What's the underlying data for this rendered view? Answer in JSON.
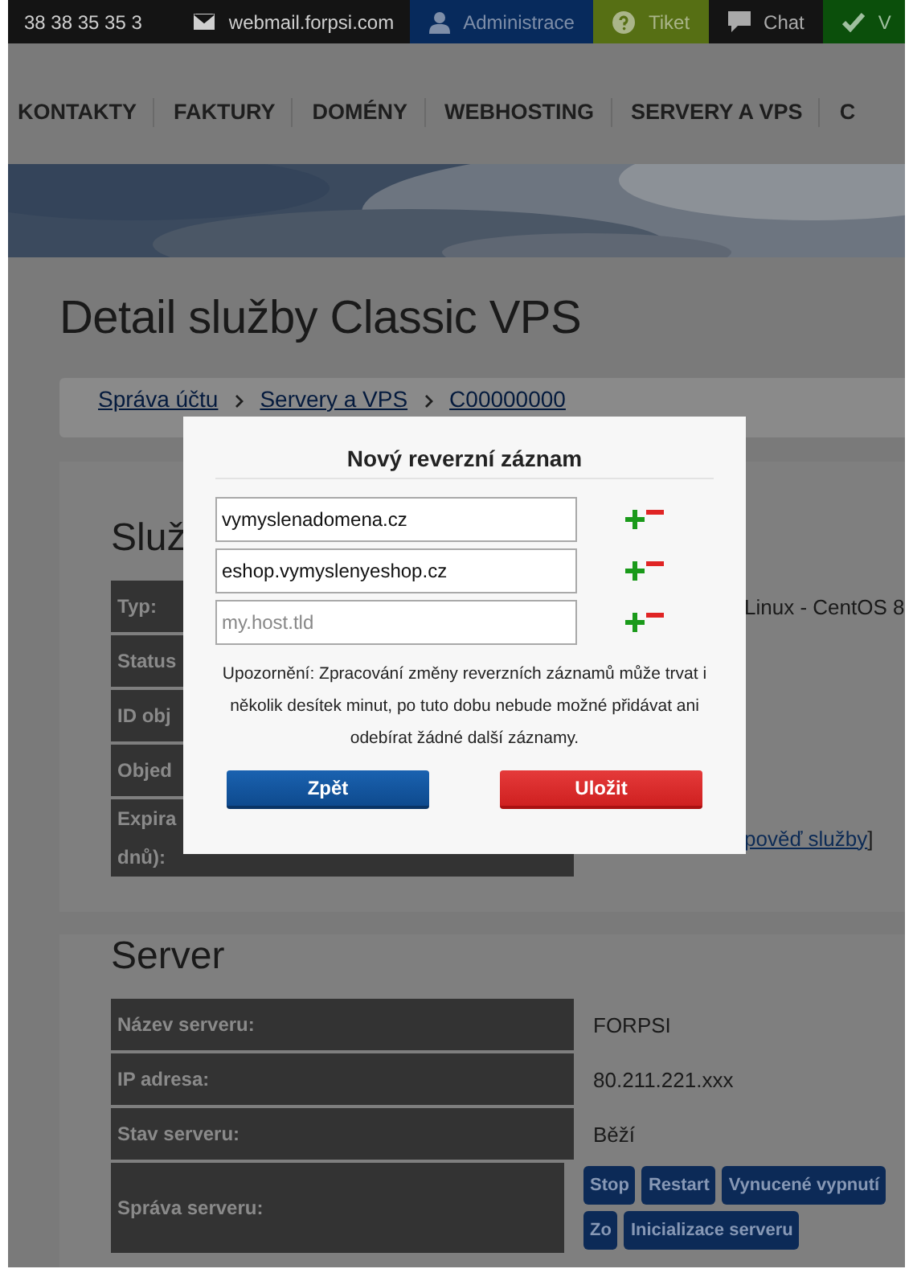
{
  "top_bar": [
    {
      "kind": "phone",
      "label": "38 38 35 35 3"
    },
    {
      "kind": "mail",
      "label": "webmail.forpsi.com"
    },
    {
      "kind": "user",
      "label": "Administrace",
      "color": "#072a5c"
    },
    {
      "kind": "help",
      "label": "Tiket",
      "color": "#566f14"
    },
    {
      "kind": "chat",
      "label": "Chat",
      "color": "#141414"
    },
    {
      "kind": "check",
      "label": "V",
      "color": "#0b4f0b"
    }
  ],
  "nav": [
    "KONTAKTY",
    "FAKTURY",
    "DOMÉNY",
    "WEBHOSTING",
    "SERVERY A VPS",
    "C"
  ],
  "hero": {
    "kind": "picture"
  },
  "page_title": "Detail služby Classic VPS",
  "breadcrumb": [
    "Správa účtu",
    "Servery a VPS",
    "C00000000"
  ],
  "sections": [
    {
      "title": "Služ",
      "rows": [
        {
          "label": [
            "Typ:"
          ],
          "value": "Linux - CentOS 8"
        },
        {
          "label": [
            "Status"
          ]
        },
        {
          "label": [
            "ID obj"
          ]
        },
        {
          "label": [
            "Objed"
          ]
        },
        {
          "label": [
            "Expira",
            "dnů):"
          ],
          "link": "pověď služby",
          "suffix": "]"
        }
      ]
    },
    {
      "title": "Server",
      "rows": [
        {
          "label": [
            "Název serveru:"
          ],
          "value": "FORPSI"
        },
        {
          "label": [
            "IP adresa:"
          ],
          "value": "80.211.221.xxx"
        },
        {
          "label": [
            "Stav serveru:"
          ],
          "value": "Běží"
        },
        {
          "label": [
            "Správa serveru:"
          ],
          "buttons": [
            "Stop",
            "Restart",
            "Vynucené vypnutí",
            "Zo",
            "Inicializace serveru"
          ]
        }
      ]
    }
  ],
  "dialog": {
    "title": "Nový reverzní záznam",
    "records": [
      {
        "value": "vymyslenadomena.cz"
      },
      {
        "value": "eshop.vymyslenyeshop.cz"
      },
      {
        "placeholder": "my.host.tld"
      }
    ],
    "notice": "Upozornění: Zpracování změny reverzních záznamů může trvat i několik desítek minut, po tuto dobu nebude možné přidávat ani odebírat žádné další záznamy.",
    "buttons": [
      {
        "kind": "back",
        "label": "Zpět"
      },
      {
        "kind": "save",
        "label": "Uložit"
      }
    ]
  }
}
